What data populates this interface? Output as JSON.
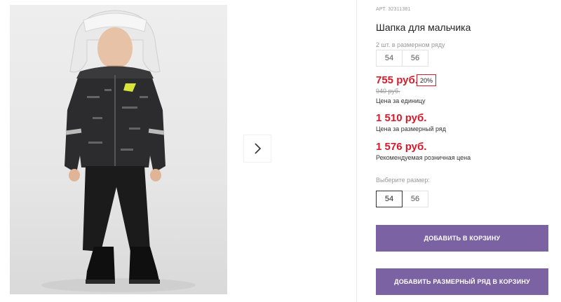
{
  "product": {
    "article": "АРТ. 32311381",
    "title": "Шапка для мальчика"
  },
  "pack": {
    "label": "2 шт. в размерном ряду",
    "sizes": [
      "54",
      "56"
    ]
  },
  "prices": {
    "unit_price": "755 руб.",
    "discount": "20%",
    "old_price": "940 руб.",
    "unit_caption": "Цена за единицу",
    "pack_price": "1 510 руб.",
    "pack_caption": "Цена за размерный ряд",
    "retail_price": "1 576 руб.",
    "retail_caption": "Рекомендуемая розничная цена"
  },
  "size_picker": {
    "label": "Выберите размер:",
    "sizes": [
      "54",
      "56"
    ],
    "selected": "54"
  },
  "buttons": {
    "add_to_cart": "ДОБАВИТЬ В КОРЗИНУ",
    "add_pack_to_cart": "ДОБАВИТЬ РАЗМЕРНЫЙ РЯД В КОРЗИНУ"
  },
  "colors": {
    "price_red": "#d9182a",
    "button_purple": "#7b62a3"
  },
  "icons": {
    "next": "chevron-right-icon"
  }
}
